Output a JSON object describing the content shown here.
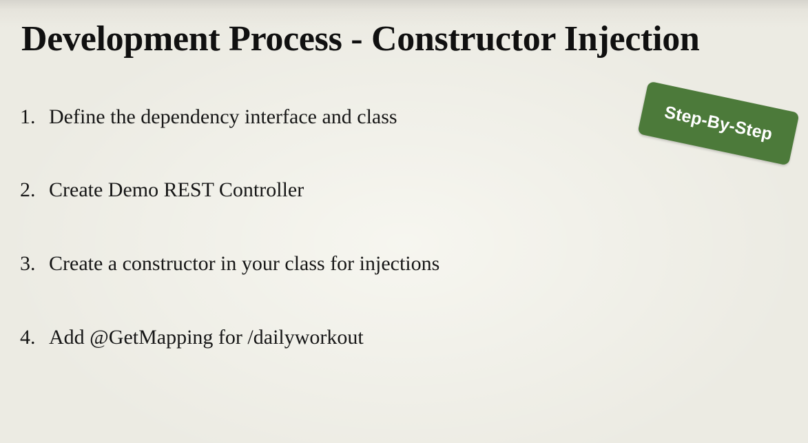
{
  "slide": {
    "title": "Development Process - Constructor Injection",
    "steps": [
      {
        "number": "1.",
        "text": "Define the dependency interface and class"
      },
      {
        "number": "2.",
        "text": "Create Demo REST Controller"
      },
      {
        "number": "3.",
        "text": "Create a constructor in your class for injections"
      },
      {
        "number": "4.",
        "text": "Add @GetMapping for /dailyworkout"
      }
    ],
    "badge": {
      "label": "Step-By-Step",
      "color": "#4c7a3a",
      "text_color": "#ffffff"
    },
    "colors": {
      "background": "#ecebe3",
      "text": "#141414"
    }
  }
}
